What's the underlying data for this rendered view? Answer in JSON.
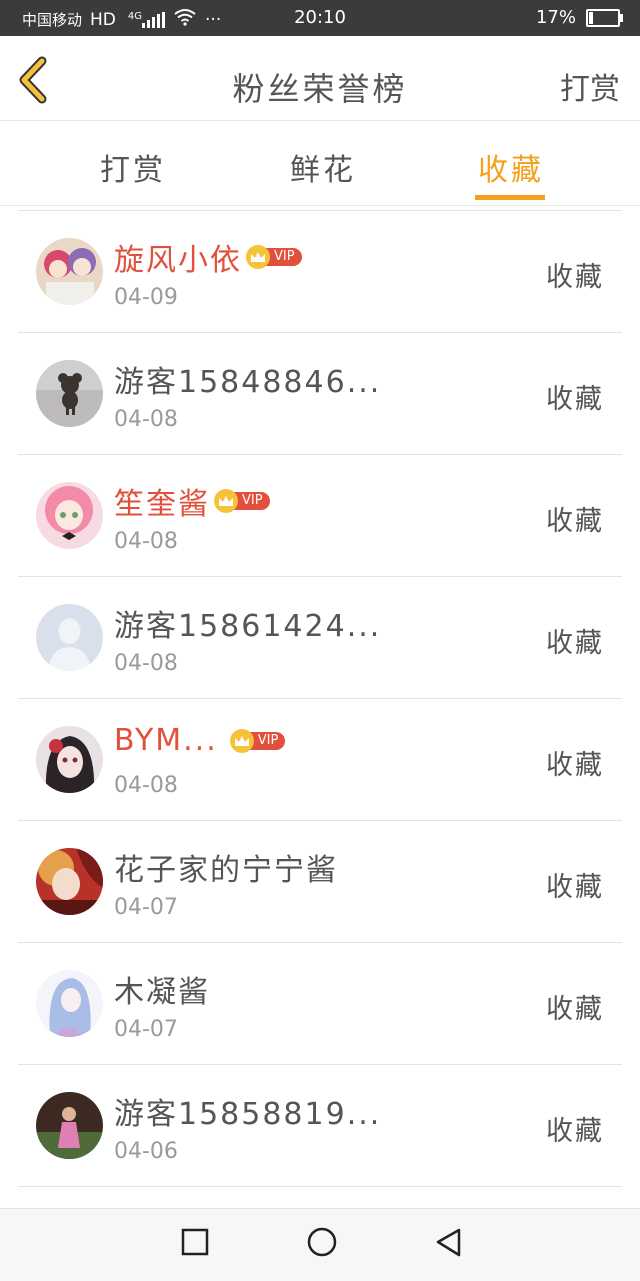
{
  "status": {
    "carrier": "中国移动",
    "hd": "HD",
    "network": "4G",
    "dots": "···",
    "time": "20:10",
    "battery_percent": "17%",
    "battery_level": 0.17
  },
  "header": {
    "title": "粉丝荣誉榜",
    "right_action": "打赏"
  },
  "tabs": [
    {
      "label": "打赏",
      "active": false
    },
    {
      "label": "鲜花",
      "active": false
    },
    {
      "label": "收藏",
      "active": true
    }
  ],
  "colors": {
    "accent": "#f2a21c",
    "vip_name": "#e2503c",
    "text": "#555555",
    "date": "#9a9a9a"
  },
  "badge": {
    "vip_label": "VIP"
  },
  "list": [
    {
      "name": "旋风小依",
      "date": "04-09",
      "action": "收藏",
      "vip": true,
      "avatar": "anime-girls-avatar"
    },
    {
      "name": "游客15848846...",
      "date": "04-08",
      "action": "收藏",
      "vip": false,
      "avatar": "teddy-bear-avatar"
    },
    {
      "name": "笙奎酱",
      "date": "04-08",
      "action": "收藏",
      "vip": true,
      "avatar": "pink-hair-girl-avatar"
    },
    {
      "name": "游客15861424...",
      "date": "04-08",
      "action": "收藏",
      "vip": false,
      "avatar": "default-user-avatar"
    },
    {
      "name": "BYM...",
      "date": "04-08",
      "action": "收藏",
      "vip": true,
      "avatar": "dark-hair-girl-avatar"
    },
    {
      "name": "花子家的宁宁酱",
      "date": "04-07",
      "action": "收藏",
      "vip": false,
      "avatar": "red-fire-anime-avatar"
    },
    {
      "name": "木凝酱",
      "date": "04-07",
      "action": "收藏",
      "vip": false,
      "avatar": "blue-hair-girl-avatar"
    },
    {
      "name": "游客15858819...",
      "date": "04-06",
      "action": "收藏",
      "vip": false,
      "avatar": "pink-outfit-photo-avatar"
    }
  ]
}
